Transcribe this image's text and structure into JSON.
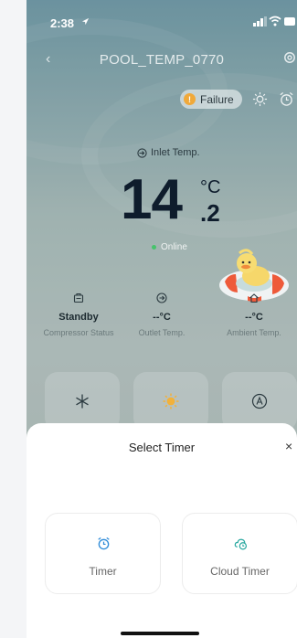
{
  "status_bar": {
    "time": "2:38"
  },
  "header": {
    "title": "POOL_TEMP_0770"
  },
  "alert": {
    "label": "Failure"
  },
  "reading": {
    "label": "Inlet Temp.",
    "value_int": "14",
    "value_dec": ".2",
    "unit": "°C",
    "connection": "Online"
  },
  "stats": [
    {
      "value": "Standby",
      "label": "Compressor Status"
    },
    {
      "value": "--°C",
      "label": "Outlet Temp."
    },
    {
      "value": "--°C",
      "label": "Ambient Temp."
    }
  ],
  "sheet": {
    "title": "Select Timer",
    "close": "×",
    "options": [
      {
        "label": "Timer"
      },
      {
        "label": "Cloud Timer"
      }
    ]
  },
  "colors": {
    "accent": "#2e8bd8",
    "cloud_accent": "#2aa8a0",
    "warning": "#f0a93a",
    "online": "#46c36b"
  }
}
